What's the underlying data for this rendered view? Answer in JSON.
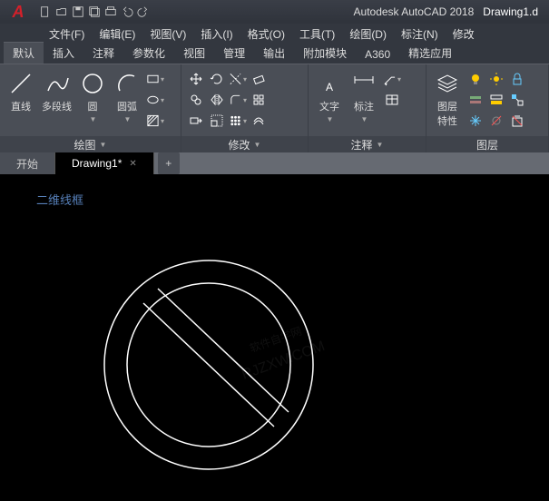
{
  "title": {
    "app": "Autodesk AutoCAD 2018",
    "doc": "Drawing1.d"
  },
  "menubar": [
    "文件(F)",
    "编辑(E)",
    "视图(V)",
    "插入(I)",
    "格式(O)",
    "工具(T)",
    "绘图(D)",
    "标注(N)",
    "修改"
  ],
  "ribbontabs": [
    "默认",
    "插入",
    "注释",
    "参数化",
    "视图",
    "管理",
    "输出",
    "附加模块",
    "A360",
    "精选应用"
  ],
  "draw": {
    "line": "直线",
    "pline": "多段线",
    "circle": "圆",
    "arc": "圆弧",
    "title": "绘图"
  },
  "modify": {
    "title": "修改"
  },
  "annot": {
    "text": "文字",
    "dim": "标注",
    "title": "注释"
  },
  "layer": {
    "prop": "图层\n特性",
    "title": "图层"
  },
  "doctabs": {
    "start": "开始",
    "d1": "Drawing1*"
  },
  "viewport": {
    "style": "二维线框"
  },
  "watermark": {
    "l1": "软件自学网",
    "l2": "RJZXW.COM"
  }
}
